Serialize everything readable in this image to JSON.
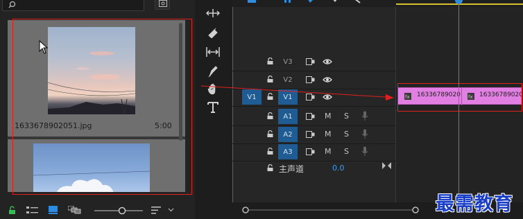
{
  "project_panel": {
    "items": [
      {
        "name": "1633678902051.jpg",
        "duration": "5:00"
      },
      {
        "name": "",
        "duration": ""
      }
    ]
  },
  "timeline": {
    "video_tracks": [
      {
        "name": "V3"
      },
      {
        "name": "V2"
      },
      {
        "name": "V1",
        "source_patch": "V1"
      }
    ],
    "audio_tracks": [
      {
        "name": "A1",
        "m": "M",
        "s": "S"
      },
      {
        "name": "A2",
        "m": "M",
        "s": "S"
      },
      {
        "name": "A3",
        "m": "M",
        "s": "S"
      }
    ],
    "master": {
      "label": "主声道",
      "value": "0.0"
    },
    "clips": [
      {
        "label": "16336789020"
      },
      {
        "label": "16336789020"
      }
    ]
  },
  "watermark": "最需教育",
  "colors": {
    "track_blue": "#1f5c93",
    "clip_pink": "#e27fe2",
    "playhead": "#2f8de0",
    "annotation_red": "#e21f1f",
    "watermark": "#1a3fc6"
  }
}
